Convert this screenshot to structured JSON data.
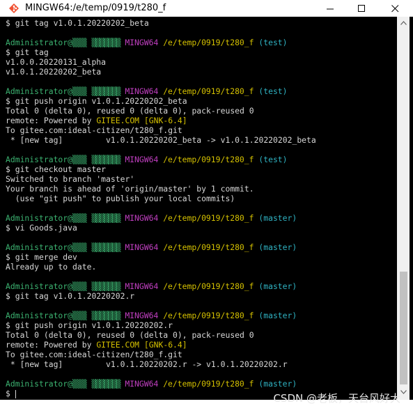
{
  "window": {
    "title": "MINGW64:/e/temp/0919/t280_f",
    "icon": "git-bash-icon"
  },
  "colors": {
    "background": "#000000",
    "default_text": "#d0d0d0",
    "user_host": "#3cb371",
    "mingw": "#c13fc1",
    "path": "#d4c000",
    "branch": "#2fb2c2"
  },
  "terminal": {
    "prompt": {
      "user_host": "Administrator@▒▒▒",
      "host_blurred": "▒▒▒▒▒▒▒",
      "shell": "MINGW64",
      "path": "/e/temp/0919/t280_f"
    },
    "lines": [
      {
        "kind": "cmd",
        "text": "$ git tag v1.0.1.20220202_beta"
      },
      {
        "kind": "blank",
        "text": ""
      },
      {
        "kind": "prompt",
        "branch": "(test)"
      },
      {
        "kind": "cmd",
        "text": "$ git tag"
      },
      {
        "kind": "out",
        "text": "v1.0.0.20220131_alpha"
      },
      {
        "kind": "out",
        "text": "v1.0.1.20220202_beta"
      },
      {
        "kind": "blank",
        "text": ""
      },
      {
        "kind": "prompt",
        "branch": "(test)"
      },
      {
        "kind": "cmd",
        "text": "$ git push origin v1.0.1.20220202_beta"
      },
      {
        "kind": "out",
        "text": "Total 0 (delta 0), reused 0 (delta 0), pack-reused 0"
      },
      {
        "kind": "remote",
        "pre": "remote: Powered by ",
        "hl1": "GITEE.COM",
        "mid": " ",
        "hl2": "[GNK-6.4]"
      },
      {
        "kind": "out",
        "text": "To gitee.com:ideal-citizen/t280_f.git"
      },
      {
        "kind": "out",
        "text": " * [new tag]         v1.0.1.20220202_beta -> v1.0.1.20220202_beta"
      },
      {
        "kind": "blank",
        "text": ""
      },
      {
        "kind": "prompt",
        "branch": "(test)"
      },
      {
        "kind": "cmd",
        "text": "$ git checkout master"
      },
      {
        "kind": "out",
        "text": "Switched to branch 'master'"
      },
      {
        "kind": "out",
        "text": "Your branch is ahead of 'origin/master' by 1 commit."
      },
      {
        "kind": "out",
        "text": "  (use \"git push\" to publish your local commits)"
      },
      {
        "kind": "blank",
        "text": ""
      },
      {
        "kind": "prompt",
        "branch": "(master)"
      },
      {
        "kind": "cmd",
        "text": "$ vi Goods.java"
      },
      {
        "kind": "blank",
        "text": ""
      },
      {
        "kind": "prompt",
        "branch": "(master)"
      },
      {
        "kind": "cmd",
        "text": "$ git merge dev"
      },
      {
        "kind": "out",
        "text": "Already up to date."
      },
      {
        "kind": "blank",
        "text": ""
      },
      {
        "kind": "prompt",
        "branch": "(master)"
      },
      {
        "kind": "cmd",
        "text": "$ git tag v1.0.1.20220202.r"
      },
      {
        "kind": "blank",
        "text": ""
      },
      {
        "kind": "prompt",
        "branch": "(master)"
      },
      {
        "kind": "cmd",
        "text": "$ git push origin v1.0.1.20220202.r"
      },
      {
        "kind": "out",
        "text": "Total 0 (delta 0), reused 0 (delta 0), pack-reused 0"
      },
      {
        "kind": "remote",
        "pre": "remote: Powered by ",
        "hl1": "GITEE.COM",
        "mid": " ",
        "hl2": "[GNK-6.4]"
      },
      {
        "kind": "out",
        "text": "To gitee.com:ideal-citizen/t280_f.git"
      },
      {
        "kind": "out",
        "text": " * [new tag]         v1.0.1.20220202.r -> v1.0.1.20220202.r"
      },
      {
        "kind": "blank",
        "text": ""
      },
      {
        "kind": "prompt",
        "branch": "(master)"
      },
      {
        "kind": "input",
        "text": "$ "
      }
    ]
  },
  "watermark": "CSDN @老板，天台风好大"
}
